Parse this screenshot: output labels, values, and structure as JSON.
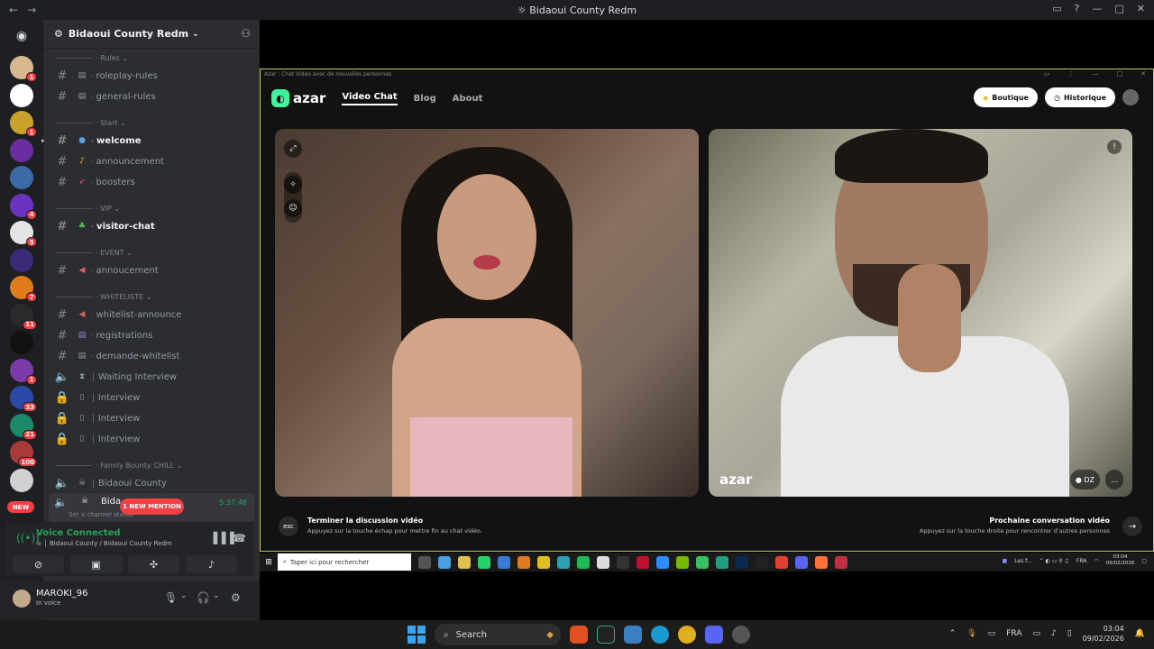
{
  "window": {
    "title": "Bidaoui County Redm"
  },
  "servers": [
    {
      "name": "server-1",
      "badge": "1",
      "color": "#d8b88e"
    },
    {
      "name": "server-2",
      "badge": "",
      "color": "#ffffff"
    },
    {
      "name": "server-3",
      "badge": "1",
      "color": "#c8a22a"
    },
    {
      "name": "server-4",
      "badge": "",
      "color": "#6a2ea0"
    },
    {
      "name": "server-5",
      "badge": "",
      "color": "#3a6aa8"
    },
    {
      "name": "server-6",
      "badge": "4",
      "color": "#6a34c0"
    },
    {
      "name": "server-7",
      "badge": "5",
      "color": "#e4e4e4"
    },
    {
      "name": "server-8",
      "badge": "",
      "color": "#3b2a78"
    },
    {
      "name": "server-9",
      "badge": "7",
      "color": "#e07a1a"
    },
    {
      "name": "server-10",
      "badge": "11",
      "color": "#2a2a2a"
    },
    {
      "name": "server-11",
      "badge": "",
      "color": "#111111"
    },
    {
      "name": "server-12",
      "badge": "1",
      "color": "#7a3aa8"
    },
    {
      "name": "server-13",
      "badge": "33",
      "color": "#2a4aa8"
    },
    {
      "name": "server-14",
      "badge": "21",
      "color": "#1a8a6a"
    },
    {
      "name": "server-15",
      "badge": "100",
      "color": "#a83a3a"
    },
    {
      "name": "server-16",
      "badge": "",
      "color": "#d0d0d0"
    }
  ],
  "new_badge": "NEW",
  "guild": {
    "name": "Bidaoui County Redm"
  },
  "categories": {
    "rules": "Rules",
    "start": "Start",
    "vip": "VIP",
    "event": "EVENT",
    "whiteliste": "WHITELISTE",
    "family": "Family Bounty CHILL"
  },
  "channels": {
    "roleplay_rules": "roleplay-rules",
    "general_rules": "general-rules",
    "welcome": "welcome",
    "announcement": "announcement",
    "boosters": "boosters",
    "visitor_chat": "visitor-chat",
    "annoucement": "annoucement",
    "whitelist_announce": "whitelist-announce",
    "registrations": "registrations",
    "demande_whitelist": "demande-whitelist",
    "waiting_interview": "Waiting Interview",
    "interview1": "Interview",
    "interview2": "Interview",
    "interview3": "Interview",
    "bidaoui_county": "Bidaoui County",
    "selected": "Bida",
    "selected_time": "5:37:46",
    "selected_status": "Set a channel status"
  },
  "mention_badge": "1 NEW MENTION",
  "voice": {
    "status": "Voice Connected",
    "location": "Bidaoui County / Bidaoui County Redm"
  },
  "user": {
    "name": "MAROKI_96",
    "status": "In voice"
  },
  "azar": {
    "window_title": "Azar : Chat Vidéo avec de nouvelles personnes",
    "logo": "azar",
    "nav": [
      "Video Chat",
      "Blog",
      "About"
    ],
    "boutique": "Boutique",
    "historique": "Historique",
    "watermark": "azar",
    "esc": "esc",
    "end_title": "Terminer la discussion vidéo",
    "end_sub": "Appuyez sur la touche échap pour mettre fin au chat vidéo.",
    "next_title": "Prochaine conversation vidéo",
    "next_sub": "Appuyez sur la touche droite pour rencontrer d'autres personnes",
    "peer_country": "DZ"
  },
  "inner_taskbar": {
    "search_placeholder": "Taper ici pour rechercher",
    "task_label": "Les f...",
    "lang": "FRA",
    "time": "03:04",
    "date": "09/02/2026"
  },
  "taskbar": {
    "search": "Search",
    "lang": "FRA",
    "time": "03:04",
    "date": "09/02/2026"
  }
}
